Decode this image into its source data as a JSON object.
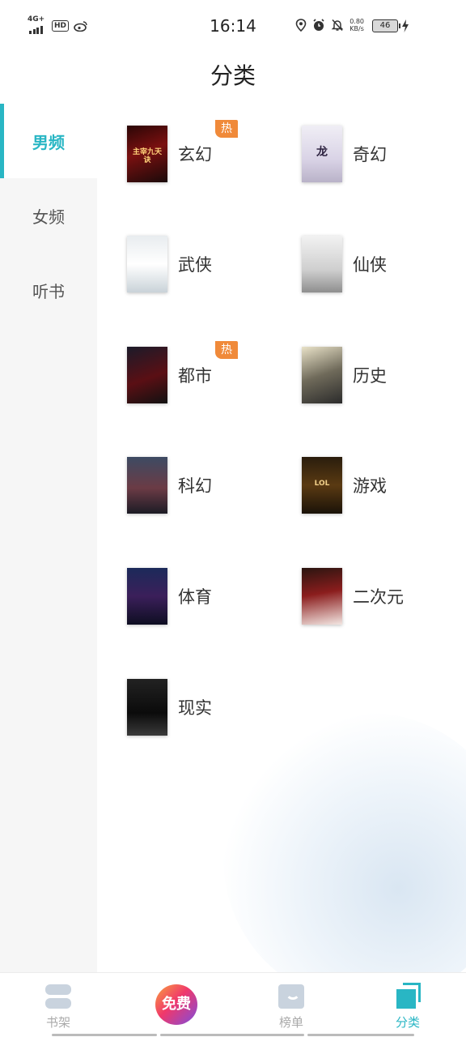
{
  "status_bar": {
    "network": "4G+",
    "hd": "HD",
    "time": "16:14",
    "speed_value": "0.80",
    "speed_unit": "KB/s",
    "battery": "46"
  },
  "header": {
    "title": "分类"
  },
  "sidebar": {
    "items": [
      {
        "label": "男频",
        "active": true
      },
      {
        "label": "女频",
        "active": false
      },
      {
        "label": "听书",
        "active": false
      }
    ]
  },
  "categories": [
    {
      "label": "玄幻",
      "hot": "热",
      "cover_title": "主宰九天诀"
    },
    {
      "label": "奇幻",
      "hot": "",
      "cover_title": "龙"
    },
    {
      "label": "武侠",
      "hot": "",
      "cover_title": ""
    },
    {
      "label": "仙侠",
      "hot": "",
      "cover_title": ""
    },
    {
      "label": "都市",
      "hot": "热",
      "cover_title": ""
    },
    {
      "label": "历史",
      "hot": "",
      "cover_title": ""
    },
    {
      "label": "科幻",
      "hot": "",
      "cover_title": ""
    },
    {
      "label": "游戏",
      "hot": "",
      "cover_title": "LOL"
    },
    {
      "label": "体育",
      "hot": "",
      "cover_title": ""
    },
    {
      "label": "二次元",
      "hot": "",
      "cover_title": ""
    },
    {
      "label": "现实",
      "hot": "",
      "cover_title": ""
    }
  ],
  "bottom_nav": {
    "shelf": "书架",
    "free": "免费",
    "rank": "榜单",
    "category": "分类"
  },
  "colors": {
    "accent": "#29b6c4",
    "hot_badge": "#f08a3a"
  }
}
